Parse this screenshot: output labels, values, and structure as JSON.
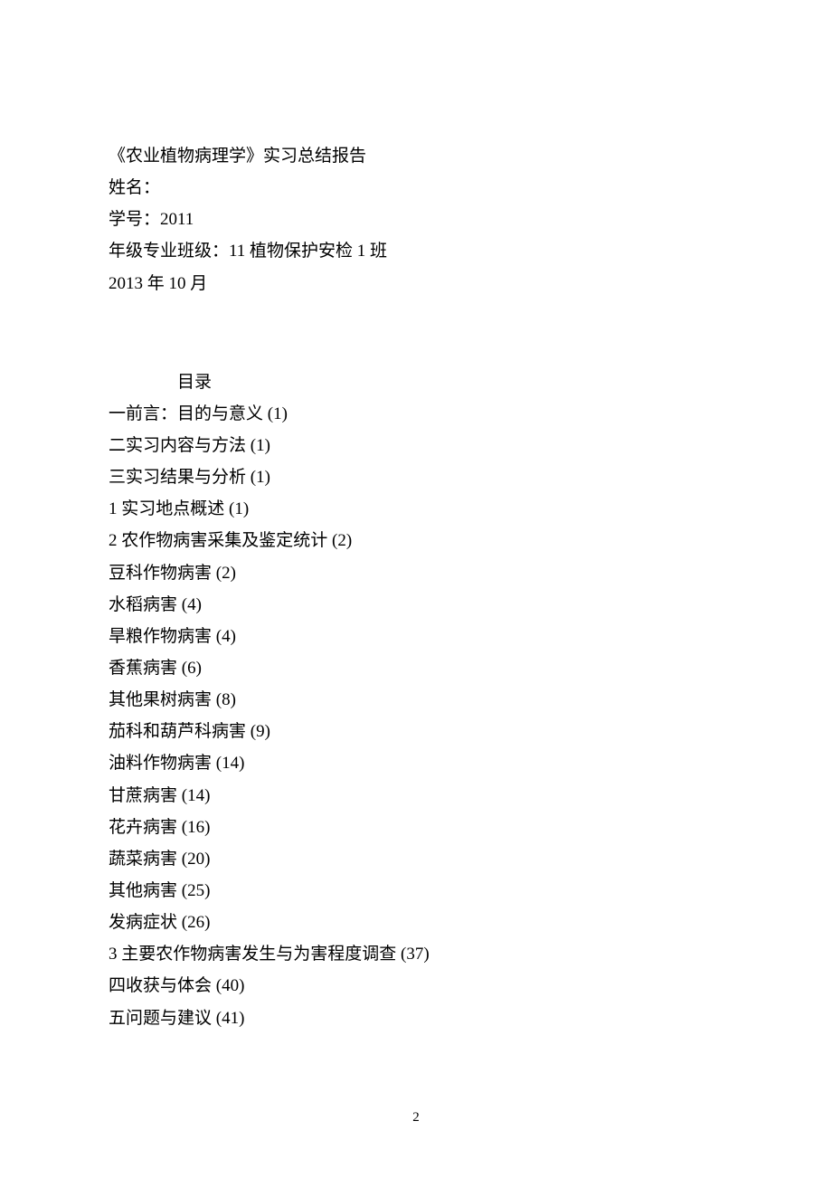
{
  "header": {
    "title": "《农业植物病理学》实习总结报告",
    "name_label": "姓名：",
    "student_id_label": "学号：2011",
    "class_label": "年级专业班级：11 植物保护安检 1 班",
    "date": "2013 年 10 月"
  },
  "toc": {
    "heading": "目录",
    "items": [
      "一前言：目的与意义 (1)",
      "二实习内容与方法 (1)",
      "三实习结果与分析 (1)",
      "1 实习地点概述 (1)",
      "2 农作物病害采集及鉴定统计 (2)",
      "豆科作物病害 (2)",
      "水稻病害 (4)",
      "旱粮作物病害 (4)",
      "香蕉病害 (6)",
      "其他果树病害 (8)",
      "茄科和葫芦科病害 (9)",
      "油料作物病害 (14)",
      "甘蔗病害 (14)",
      "花卉病害 (16)",
      "蔬菜病害 (20)",
      "其他病害 (25)",
      "发病症状 (26)",
      "3 主要农作物病害发生与为害程度调查 (37)",
      "四收获与体会 (40)",
      "五问题与建议 (41)"
    ]
  },
  "page_number": "2"
}
